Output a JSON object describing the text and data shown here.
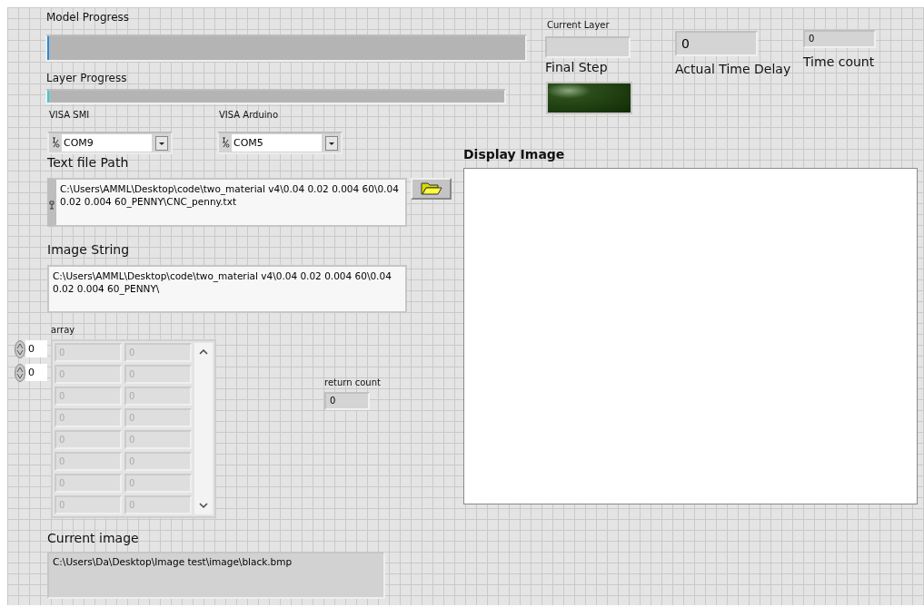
{
  "model_progress": {
    "label": "Model Progress",
    "level": 0.004
  },
  "layer_progress": {
    "label": "Layer Progress",
    "level": 0.004
  },
  "current_layer": {
    "label": "Current Layer"
  },
  "final_step": {
    "label": "Final Step",
    "on": false
  },
  "actual_time_delay": {
    "label": "Actual Time Delay",
    "value": "0"
  },
  "time_count": {
    "label": "Time count",
    "value": "0"
  },
  "visa_smi": {
    "label": "VISA SMI",
    "value": "COM9"
  },
  "visa_arduino": {
    "label": "VISA Arduino",
    "value": "COM5"
  },
  "text_file_path": {
    "label": "Text file Path",
    "value": "C:\\Users\\AMML\\Desktop\\code\\two_material v4\\0.04 0.02 0.004 60\\0.04 0.02 0.004 60_PENNY\\CNC_penny.txt"
  },
  "image_string": {
    "label": "Image String",
    "value": "C:\\Users\\AMML\\Desktop\\code\\two_material v4\\0.04 0.02 0.004 60\\0.04 0.02 0.004 60_PENNY\\"
  },
  "array": {
    "label": "array",
    "disabled": true,
    "indices": [
      "0",
      "0"
    ],
    "rows": [
      [
        "0",
        "0"
      ],
      [
        "0",
        "0"
      ],
      [
        "0",
        "0"
      ],
      [
        "0",
        "0"
      ],
      [
        "0",
        "0"
      ],
      [
        "0",
        "0"
      ],
      [
        "0",
        "0"
      ],
      [
        "0",
        "0"
      ]
    ]
  },
  "return_count": {
    "label": "return count",
    "value": "0"
  },
  "display_image": {
    "label": "Display Image"
  },
  "current_image": {
    "label": "Current image",
    "value": "C:\\Users\\Da\\Desktop\\Image test\\image\\black.bmp"
  }
}
